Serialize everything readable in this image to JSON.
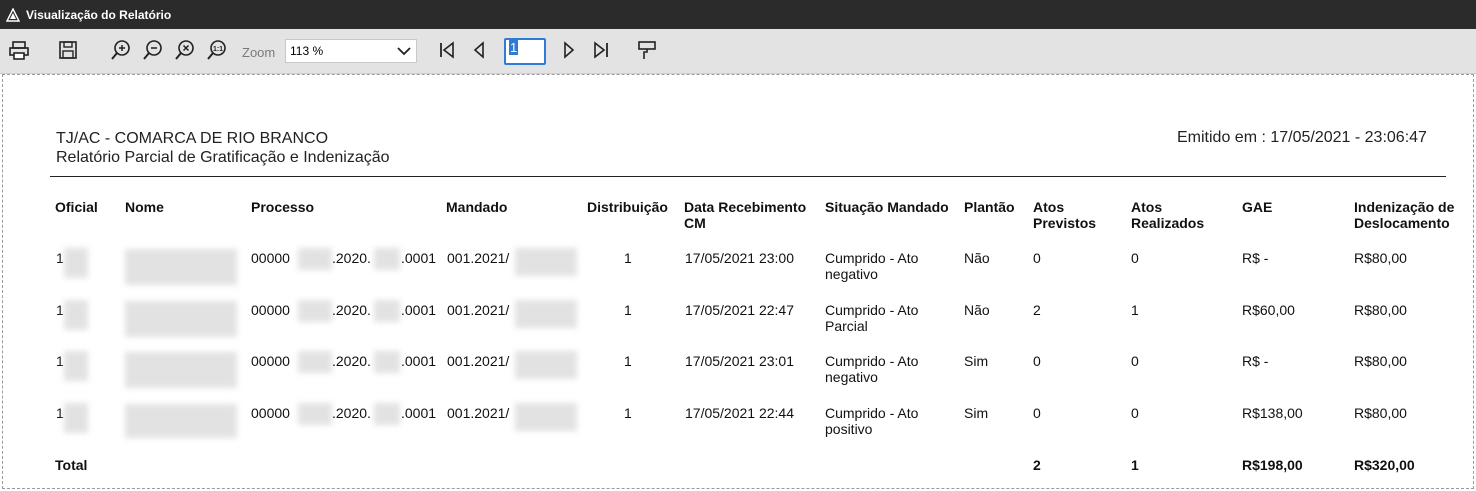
{
  "window": {
    "title": "Visualização do Relatório"
  },
  "toolbar": {
    "icons": [
      "printer-icon",
      "save-icon",
      "zoom-in-icon",
      "zoom-out-icon",
      "zoom-reset-icon",
      "zoom-actual-icon",
      "first-page-icon",
      "prev-page-icon",
      "next-page-icon",
      "last-page-icon",
      "paint-icon"
    ],
    "zoom_label": "Zoom",
    "zoom_value": "113 %",
    "page_value": "1"
  },
  "report": {
    "org": "TJ/AC - COMARCA DE RIO BRANCO",
    "title": "Relatório Parcial de Gratificação e Indenização",
    "emitted": "Emitido em : 17/05/2021 - 23:06:47",
    "columns": {
      "oficial": "Oficial",
      "nome": "Nome",
      "processo": "Processo",
      "mandado": "Mandado",
      "distribuicao": "Distribuição",
      "data_recebimento": "Data Recebimento CM",
      "situacao": "Situação Mandado",
      "plantao": "Plantão",
      "atos_previstos": "Atos Previstos",
      "atos_realizados": "Atos Realizados",
      "gae": "GAE",
      "indenizacao": "Indenização de Deslocamento"
    },
    "rows": [
      {
        "oficial": "1",
        "processo_a": "00000",
        "processo_b": ".2020.",
        "processo_c": ".0001",
        "mandado": "001.2021/",
        "distribuicao": "1",
        "data": "17/05/2021 23:00",
        "situacao": "Cumprido - Ato negativo",
        "plantao": "Não",
        "previstos": "0",
        "realizados": "0",
        "gae": "R$ -",
        "indenizacao": "R$80,00"
      },
      {
        "oficial": "1",
        "processo_a": "00000",
        "processo_b": ".2020.",
        "processo_c": ".0001",
        "mandado": "001.2021/",
        "distribuicao": "1",
        "data": "17/05/2021 22:47",
        "situacao": "Cumprido - Ato Parcial",
        "plantao": "Não",
        "previstos": "2",
        "realizados": "1",
        "gae": "R$60,00",
        "indenizacao": "R$80,00"
      },
      {
        "oficial": "1",
        "processo_a": "00000",
        "processo_b": ".2020.",
        "processo_c": ".0001",
        "mandado": "001.2021/",
        "distribuicao": "1",
        "data": "17/05/2021 23:01",
        "situacao": "Cumprido - Ato negativo",
        "plantao": "Sim",
        "previstos": "0",
        "realizados": "0",
        "gae": "R$ -",
        "indenizacao": "R$80,00"
      },
      {
        "oficial": "1",
        "processo_a": "00000",
        "processo_b": ".2020.",
        "processo_c": ".0001",
        "mandado": "001.2021/",
        "distribuicao": "1",
        "data": "17/05/2021 22:44",
        "situacao": "Cumprido - Ato positivo",
        "plantao": "Sim",
        "previstos": "0",
        "realizados": "0",
        "gae": "R$138,00",
        "indenizacao": "R$80,00"
      }
    ],
    "total": {
      "label": "Total",
      "previstos": "2",
      "realizados": "1",
      "gae": "R$198,00",
      "indenizacao": "R$320,00"
    }
  }
}
